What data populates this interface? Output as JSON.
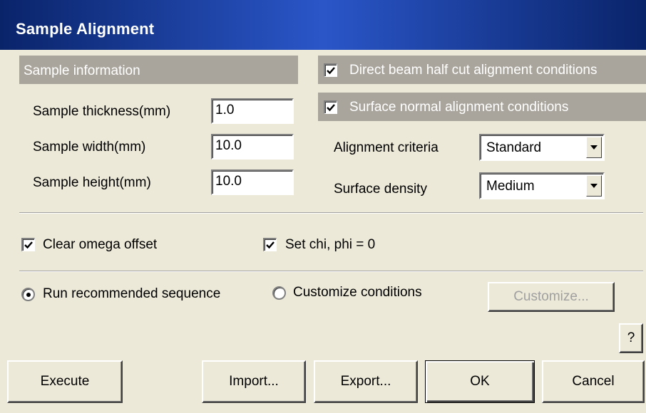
{
  "window": {
    "title": "Sample Alignment"
  },
  "sample_info": {
    "header": "Sample information",
    "thickness_label": "Sample thickness(mm)",
    "thickness_value": "1.0",
    "width_label": "Sample width(mm)",
    "width_value": "10.0",
    "height_label": "Sample height(mm)",
    "height_value": "10.0"
  },
  "conditions": {
    "direct_beam_label": "Direct beam half cut alignment conditions",
    "direct_beam_checked": true,
    "surface_normal_label": "Surface normal alignment conditions",
    "surface_normal_checked": true,
    "criteria_label": "Alignment criteria",
    "criteria_value": "Standard",
    "density_label": "Surface density",
    "density_value": "Medium"
  },
  "options": {
    "clear_omega_label": "Clear omega offset",
    "clear_omega_checked": true,
    "set_chi_phi_label": "Set chi, phi = 0",
    "set_chi_phi_checked": true
  },
  "sequence": {
    "run_recommended_label": "Run recommended sequence",
    "run_recommended_selected": true,
    "customize_conditions_label": "Customize conditions",
    "customize_button": "Customize..."
  },
  "help_button": "?",
  "footer": {
    "execute": "Execute",
    "import": "Import...",
    "export": "Export...",
    "ok": "OK",
    "cancel": "Cancel"
  }
}
